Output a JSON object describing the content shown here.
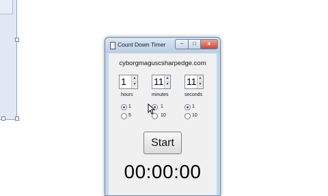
{
  "window": {
    "title": "Count Down Timer",
    "controls": {
      "minimize": "–",
      "maximize": "□",
      "close": "x"
    }
  },
  "site": "cyborgmaguscsharpedge.com",
  "spinners": [
    {
      "value": "1",
      "label": "hours"
    },
    {
      "value": "11",
      "label": "minutes"
    },
    {
      "value": "11",
      "label": "seconds"
    }
  ],
  "radio_groups": [
    {
      "options": [
        "1",
        "5"
      ],
      "selected": "1"
    },
    {
      "options": [
        "1",
        "10"
      ],
      "selected": "1"
    },
    {
      "options": [
        "1",
        "10"
      ],
      "selected": "1"
    }
  ],
  "start_button": "Start",
  "display": "00:00:00",
  "icons": {
    "spin_up": "▲",
    "spin_down": "▼"
  }
}
